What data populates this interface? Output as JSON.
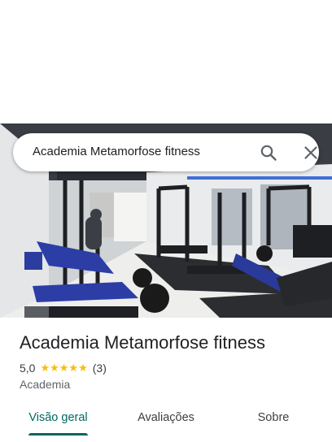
{
  "search": {
    "query": "Academia Metamorfose fitness",
    "search_icon": "search-icon",
    "close_icon": "close-icon"
  },
  "place": {
    "name": "Academia Metamorfose fitness",
    "rating": "5,0",
    "stars": "★★★★★",
    "rating_value": 5.0,
    "review_count": "(3)",
    "category": "Academia"
  },
  "tabs": [
    {
      "label": "Visão geral",
      "active": true
    },
    {
      "label": "Avaliações",
      "active": false
    },
    {
      "label": "Sobre",
      "active": false
    }
  ],
  "colors": {
    "accent": "#01675f",
    "star": "#fbbc04",
    "text_primary": "#202124",
    "text_secondary": "#5f6368"
  }
}
